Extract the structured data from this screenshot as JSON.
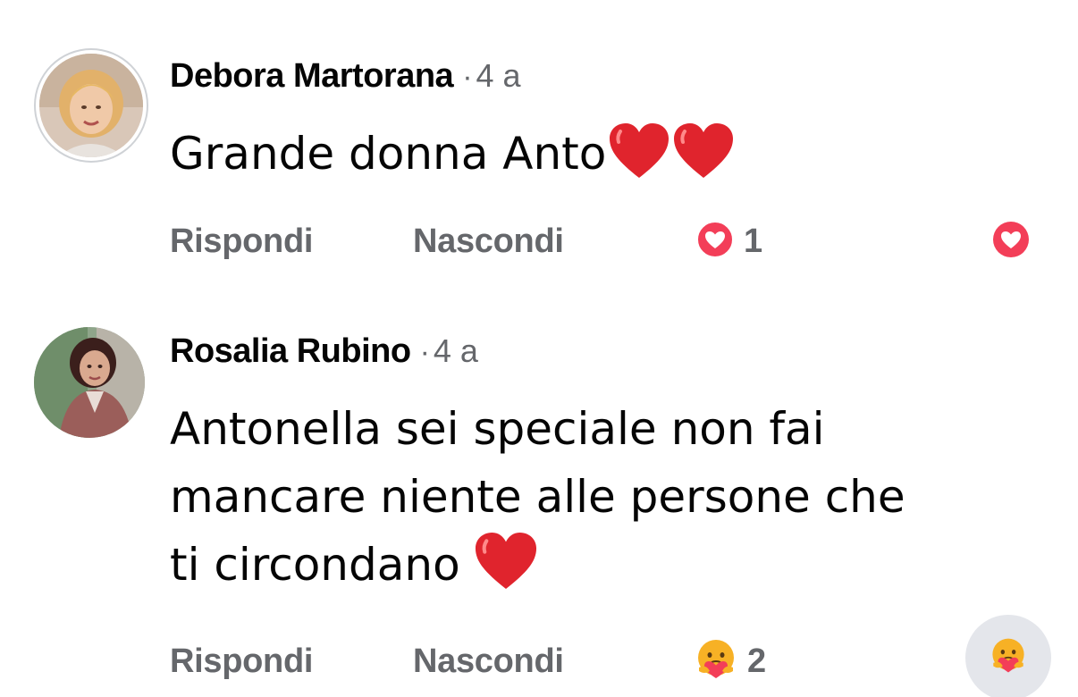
{
  "comments": [
    {
      "author": "Debora Martorana",
      "separator": "·",
      "time": "4 a",
      "text_lines": [
        "Grande donna Anto"
      ],
      "trailing_emojis": [
        "red-heart",
        "red-heart"
      ],
      "actions": {
        "reply_label": "Rispondi",
        "hide_label": "Nascondi"
      },
      "reactions": {
        "icon": "love-reaction-icon",
        "count": "1"
      },
      "react_button_icon": "love-reaction-icon"
    },
    {
      "author": "Rosalia Rubino",
      "separator": "·",
      "time": "4 a",
      "text_lines": [
        "Antonella sei speciale non fai",
        "mancare niente alle persone che",
        "ti circondano"
      ],
      "trailing_emojis": [
        "red-heart"
      ],
      "actions": {
        "reply_label": "Rispondi",
        "hide_label": "Nascondi"
      },
      "reactions": {
        "icon": "care-reaction-icon",
        "count": "2"
      },
      "react_button_icon": "care-reaction-icon"
    }
  ],
  "colors": {
    "text_primary": "#050505",
    "text_secondary": "#65676b",
    "love_reaction": "#f33e58",
    "care_reaction": "#f7b125",
    "heart_emoji": "#e0242d",
    "button_bg": "#e4e6eb"
  }
}
